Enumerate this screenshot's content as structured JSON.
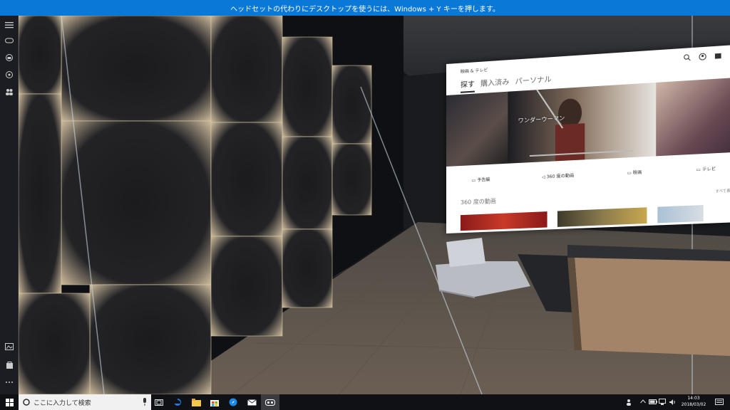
{
  "banner": {
    "text": "ヘッドセットの代わりにデスクトップを使うには、Windows + Y キーを押します。"
  },
  "left_rail": {
    "items": [
      {
        "icon": "hamburger-menu-icon"
      },
      {
        "icon": "mixed-reality-headset-icon"
      },
      {
        "icon": "boundary-icon"
      },
      {
        "icon": "controller-icon"
      },
      {
        "icon": "people-icon"
      },
      {
        "icon": "photo-icon"
      },
      {
        "icon": "store-bag-icon"
      },
      {
        "icon": "more-icon"
      }
    ]
  },
  "app_window": {
    "title": "映画 & テレビ",
    "nav": [
      "探す",
      "購入済み",
      "パーソナル"
    ],
    "hero_caption": "ワンダーウーマン",
    "categories": [
      "予告編",
      "360 度の動画",
      "映画",
      "テレビ"
    ],
    "section_title": "360 度の動画",
    "section_more": "すべて表示"
  },
  "colors": {
    "banner": "#0a78d7",
    "taskbar": "#0f1114",
    "rail": "#1b1d22",
    "edge_blue": "#1e7be3"
  },
  "taskbar": {
    "search_placeholder": "ここに入力して検索",
    "time": "14:03",
    "date": "2018/03/02"
  }
}
